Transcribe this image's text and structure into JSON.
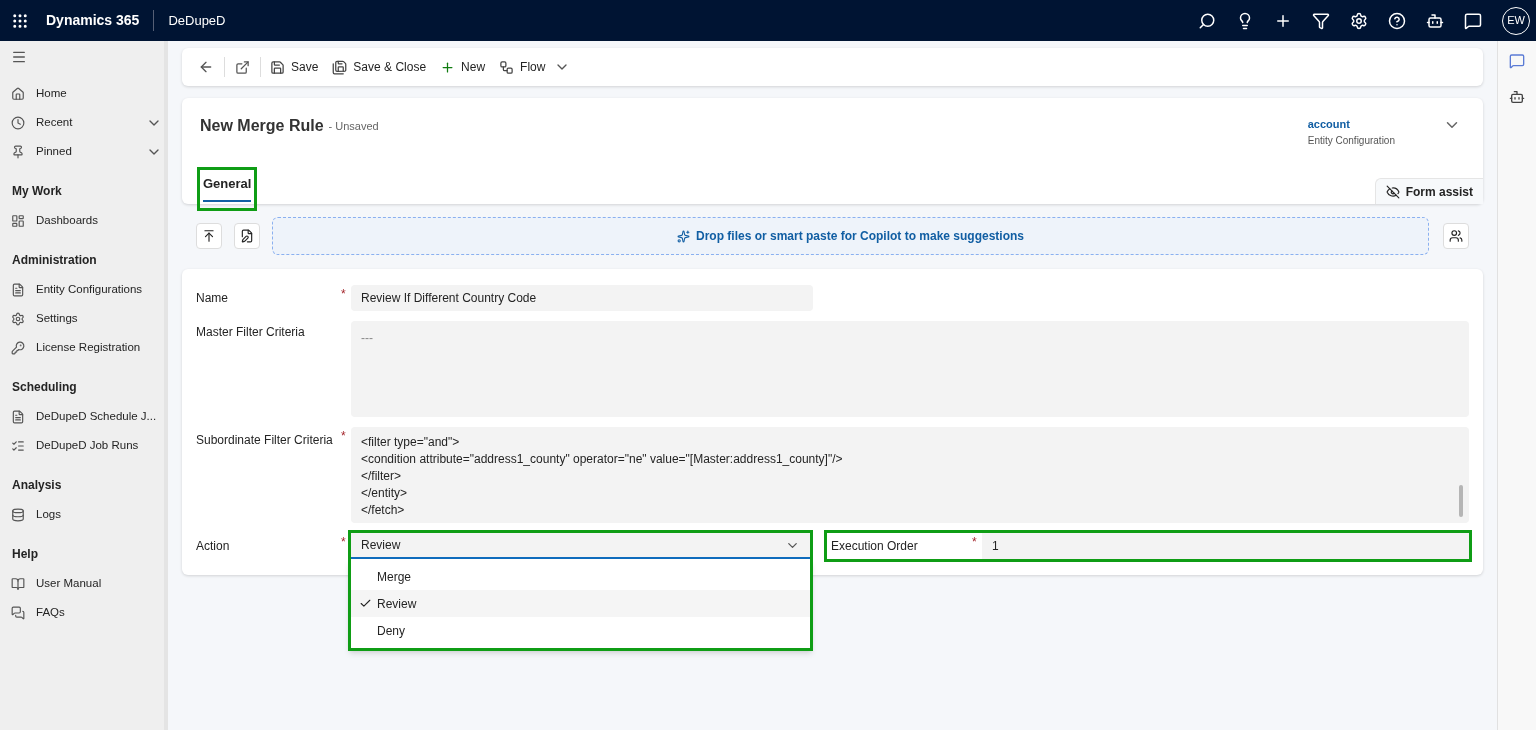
{
  "top_bar": {
    "app_name": "Dynamics 365",
    "area": "DeDupeD",
    "avatar": "EW"
  },
  "sidebar": {
    "sections": [
      {
        "items": [
          {
            "label": "Home",
            "expandable": false
          },
          {
            "label": "Recent",
            "expandable": true
          },
          {
            "label": "Pinned",
            "expandable": true
          }
        ]
      },
      {
        "heading": "My Work",
        "items": [
          {
            "label": "Dashboards",
            "expandable": false
          }
        ]
      },
      {
        "heading": "Administration",
        "items": [
          {
            "label": "Entity Configurations",
            "expandable": false
          },
          {
            "label": "Settings",
            "expandable": false
          },
          {
            "label": "License Registration",
            "expandable": false
          }
        ]
      },
      {
        "heading": "Scheduling",
        "items": [
          {
            "label": "DeDupeD Schedule J...",
            "expandable": false
          },
          {
            "label": "DeDupeD Job Runs",
            "expandable": false
          }
        ]
      },
      {
        "heading": "Analysis",
        "items": [
          {
            "label": "Logs",
            "expandable": false
          }
        ]
      },
      {
        "heading": "Help",
        "items": [
          {
            "label": "User Manual",
            "expandable": false
          },
          {
            "label": "FAQs",
            "expandable": false
          }
        ]
      }
    ]
  },
  "command_bar": {
    "buttons": [
      {
        "label": "Save"
      },
      {
        "label": "Save & Close"
      },
      {
        "label": "New"
      },
      {
        "label": "Flow"
      }
    ]
  },
  "header": {
    "title": "New Merge Rule",
    "status": "- Unsaved",
    "entity_link": "account",
    "entity_type": "Entity Configuration",
    "form_assist": "Form assist"
  },
  "tabs": [
    {
      "label": "General",
      "selected": true,
      "highlighted": true
    }
  ],
  "copilot_bar": {
    "text": "Drop files or smart paste for Copilot to make suggestions"
  },
  "form": {
    "name": {
      "label": "Name",
      "required_mark": "*",
      "value": "Review If Different Country Code"
    },
    "master_filter": {
      "label": "Master Filter Criteria",
      "placeholder": "---"
    },
    "subordinate_filter": {
      "label": "Subordinate Filter Criteria",
      "required_mark": "*",
      "lines": [
        "<filter type=\"and\">",
        "<condition attribute=\"address1_county\" operator=\"ne\" value=\"[Master:address1_county]\"/>",
        "</filter>",
        "</entity>",
        "</fetch>"
      ]
    },
    "action": {
      "label": "Action",
      "required_mark": "*",
      "value": "Review",
      "expanded": true,
      "highlighted": true,
      "options": [
        {
          "label": "Merge",
          "selected": false
        },
        {
          "label": "Review",
          "selected": true
        },
        {
          "label": "Deny",
          "selected": false
        }
      ]
    },
    "execution_order": {
      "label": "Execution Order",
      "required_mark": "*",
      "value": "1",
      "highlighted": true
    }
  }
}
